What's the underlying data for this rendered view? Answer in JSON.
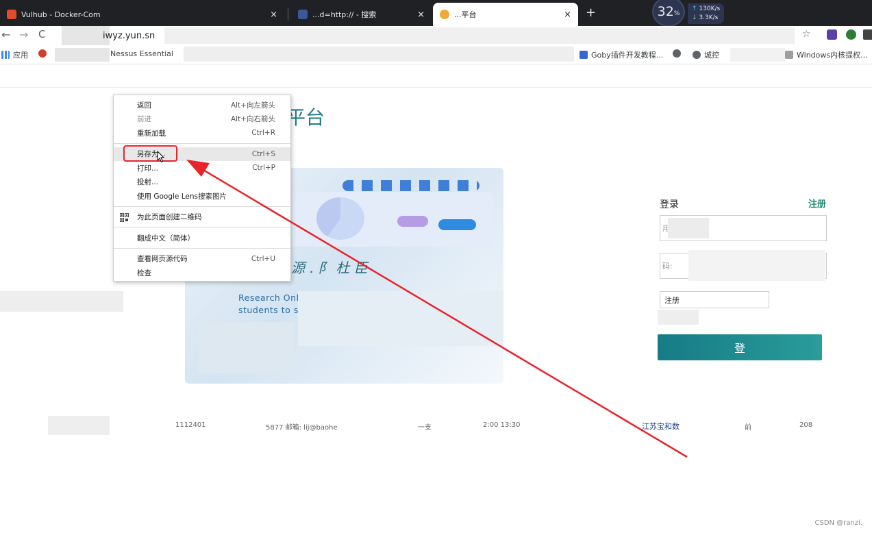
{
  "browser": {
    "tabs": [
      {
        "title": "Vulhub - Docker-Com",
        "close": "×",
        "active": false
      },
      {
        "title": "...d=http:// - 搜索",
        "close": "×",
        "active": false
      },
      {
        "title": "...平台",
        "close": "×",
        "active": true
      }
    ],
    "new_tab": "+",
    "netspeed": {
      "percent": "32",
      "percent_unit": "%",
      "up": "130K/s",
      "down": "3.3K/s"
    },
    "address": "iwyz.yun.sn",
    "nav": {
      "back": "←",
      "forward": "→",
      "reload": "C"
    },
    "star": "☆",
    "bookmarks": [
      {
        "label": "应用"
      },
      {
        "label": "Nessus Essential"
      },
      {
        "label": "Goby插件开发教程..."
      },
      {
        "label": "城控"
      },
      {
        "label": "Windows内核提权..."
      }
    ]
  },
  "page": {
    "title": "平台",
    "slogan": "源 . 阝 杜 臣",
    "hero_text": "Research Online as a one-stop researchers ar to students to sy access to th e",
    "login": {
      "title": "登录",
      "register": "注册",
      "username_placeholder": "用",
      "password_placeholder": "码:",
      "select_value": "注册",
      "button": "登"
    },
    "footer": {
      "part1": "1112401",
      "part2": "5877 邮箱: lij@baohe",
      "part3": "一支",
      "part4": "2:00 13:30",
      "part5": "江苏宝和数",
      "part6": "前",
      "part7": "208"
    },
    "watermark": "CSDN @ranzi."
  },
  "context_menu": {
    "items": [
      {
        "label": "返回",
        "shortcut": "Alt+向左箭头"
      },
      {
        "label": "前进",
        "shortcut": "Alt+向右箭头"
      },
      {
        "label": "重新加载",
        "shortcut": "Ctrl+R"
      },
      {
        "label": "另存为...",
        "shortcut": "Ctrl+S"
      },
      {
        "label": "打印...",
        "shortcut": "Ctrl+P"
      },
      {
        "label": "投射..."
      },
      {
        "label": "使用 Google Lens搜索图片"
      },
      {
        "label": "为此页面创建二维码"
      },
      {
        "label": "翻成中文（简体）"
      },
      {
        "label": "查看网页源代码",
        "shortcut": "Ctrl+U"
      },
      {
        "label": "检查"
      }
    ]
  },
  "colors": {
    "annotation": "#e8232a",
    "accent": "#1f7c8a",
    "register": "#1f8a70"
  }
}
